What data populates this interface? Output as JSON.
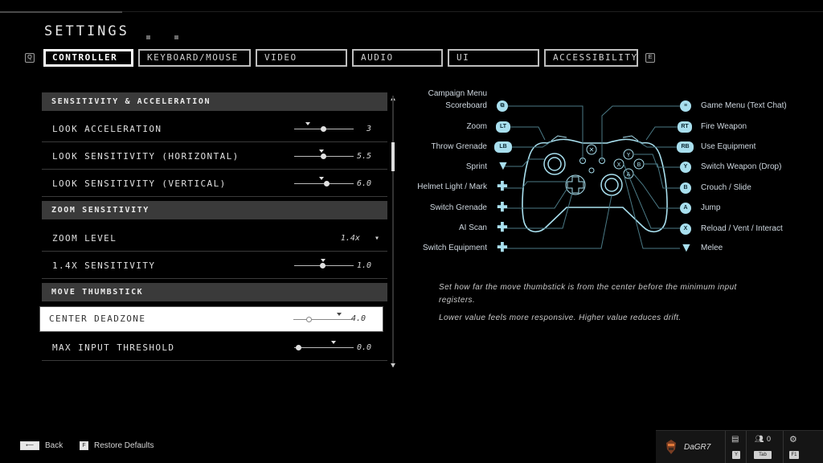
{
  "page": {
    "title": "SETTINGS"
  },
  "nav": {
    "left_key": "Q",
    "right_key": "E"
  },
  "tabs": [
    {
      "label": "CONTROLLER",
      "active": true
    },
    {
      "label": "KEYBOARD/MOUSE",
      "active": false
    },
    {
      "label": "VIDEO",
      "active": false
    },
    {
      "label": "AUDIO",
      "active": false
    },
    {
      "label": "UI",
      "active": false
    },
    {
      "label": "ACCESSIBILITY",
      "active": false
    }
  ],
  "settings": {
    "section1": "SENSITIVITY & ACCELERATION",
    "look_acceleration": {
      "label": "LOOK ACCELERATION",
      "value": "3"
    },
    "look_sens_h": {
      "label": "LOOK SENSITIVITY (HORIZONTAL)",
      "value": "5.5"
    },
    "look_sens_v": {
      "label": "LOOK SENSITIVITY (VERTICAL)",
      "value": "6.0"
    },
    "section2": "ZOOM SENSITIVITY",
    "zoom_level": {
      "label": "ZOOM LEVEL",
      "value": "1.4x",
      "arrow": "▾"
    },
    "zoom_sens": {
      "label": "1.4X SENSITIVITY",
      "value": "1.0"
    },
    "section3": "MOVE THUMBSTICK",
    "center_deadzone": {
      "label": "CENTER DEADZONE",
      "value": "4.0"
    },
    "max_input": {
      "label": "MAX INPUT THRESHOLD",
      "value": "0.0"
    }
  },
  "controller_map": {
    "left": [
      {
        "label": "Campaign Menu",
        "badge": ""
      },
      {
        "label": "Scoreboard",
        "badge": "⧉"
      },
      {
        "label": "Zoom",
        "badge": "LT"
      },
      {
        "label": "Throw Grenade",
        "badge": "LB"
      },
      {
        "label": "Sprint",
        "badge": "▼"
      },
      {
        "label": "Helmet Light / Mark",
        "badge": "✚"
      },
      {
        "label": "Switch Grenade",
        "badge": "✚"
      },
      {
        "label": "AI Scan",
        "badge": "✚"
      },
      {
        "label": "Switch Equipment",
        "badge": "✚"
      }
    ],
    "right": [
      {
        "label": "Game Menu (Text Chat)",
        "badge": "≡"
      },
      {
        "label": "Fire Weapon",
        "badge": "RT"
      },
      {
        "label": "Use Equipment",
        "badge": "RB"
      },
      {
        "label": "Switch Weapon (Drop)",
        "badge": "Y"
      },
      {
        "label": "Crouch / Slide",
        "badge": "B"
      },
      {
        "label": "Jump",
        "badge": "A"
      },
      {
        "label": "Reload / Vent / Interact",
        "badge": "X"
      },
      {
        "label": "Melee",
        "badge": "▼"
      }
    ],
    "face_buttons": {
      "y": "Y",
      "b": "B",
      "x": "X",
      "a": "A"
    },
    "accent_color": "#a8dfee"
  },
  "description": {
    "line1": "Set how far the move thumbstick is from the center before the minimum input registers.",
    "line2": "Lower value feels more responsive. Higher value reduces drift."
  },
  "footer": {
    "back_label": "Back",
    "restore_key": "F",
    "restore_label": "Restore Defaults",
    "gamertag": "DaGR7",
    "chat_key": "Y",
    "party_count": "0",
    "party_key": "Tab",
    "settings_key": "F1"
  }
}
